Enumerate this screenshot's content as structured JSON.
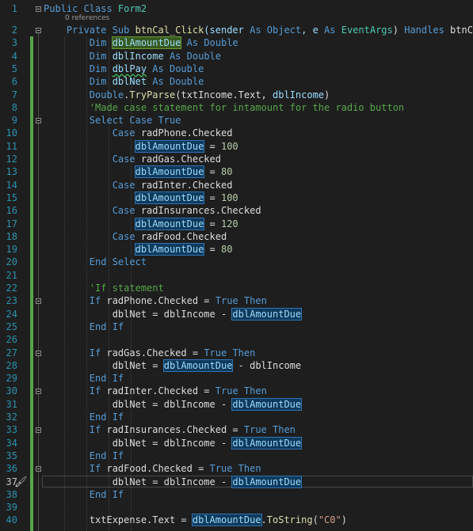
{
  "editor": {
    "reference_hint": "0 references",
    "current_line": 37,
    "colors": {
      "background": "#1e1e1e",
      "line_numbers": "#2b91af",
      "keyword": "#569cd6",
      "type": "#4ec9b0",
      "method": "#dcdcaa",
      "comment": "#57a64a",
      "number": "#b5cea8",
      "string": "#d69d85",
      "highlight": "#0e3a5c"
    },
    "icons": {
      "quick_action": "paintbrush-icon",
      "fold": "collapse-icon"
    }
  },
  "lines": [
    {
      "num": "1",
      "tokens": [
        {
          "t": "Public Class ",
          "c": "k"
        },
        {
          "t": "Form2",
          "c": "t"
        }
      ]
    },
    {
      "num": "2",
      "tokens": [
        {
          "t": "    Private Sub ",
          "c": "k"
        },
        {
          "t": "btnCal_Click",
          "c": "f"
        },
        {
          "t": "(sender ",
          "c": "v"
        },
        {
          "t": "As ",
          "c": "k"
        },
        {
          "t": "Object",
          "c": "k"
        },
        {
          "t": ", e ",
          "c": "v"
        },
        {
          "t": "As ",
          "c": "k"
        },
        {
          "t": "EventArgs",
          "c": "t"
        },
        {
          "t": ") ",
          "c": "p"
        },
        {
          "t": "Handles ",
          "c": "k"
        },
        {
          "t": "btnCal.C",
          "c": "p"
        }
      ]
    },
    {
      "num": "3",
      "tokens": [
        {
          "t": "        Dim ",
          "c": "k"
        },
        {
          "t": "dblAmountDue",
          "c": "v",
          "hl": "def"
        },
        {
          "t": " As ",
          "c": "k"
        },
        {
          "t": "Double",
          "c": "k"
        }
      ]
    },
    {
      "num": "4",
      "tokens": [
        {
          "t": "        Dim ",
          "c": "k"
        },
        {
          "t": "dblIncome",
          "c": "v"
        },
        {
          "t": " As ",
          "c": "k"
        },
        {
          "t": "Double",
          "c": "k"
        }
      ]
    },
    {
      "num": "5",
      "tokens": [
        {
          "t": "        Dim ",
          "c": "k"
        },
        {
          "t": "dblPay",
          "c": "v",
          "sq": true
        },
        {
          "t": " As ",
          "c": "k"
        },
        {
          "t": "Double",
          "c": "k"
        }
      ]
    },
    {
      "num": "6",
      "tokens": [
        {
          "t": "        Dim ",
          "c": "k"
        },
        {
          "t": "dblNet",
          "c": "v"
        },
        {
          "t": " As ",
          "c": "k"
        },
        {
          "t": "Double",
          "c": "k"
        }
      ]
    },
    {
      "num": "7",
      "tokens": [
        {
          "t": "        Double",
          "c": "k"
        },
        {
          "t": ".",
          "c": "p"
        },
        {
          "t": "TryParse",
          "c": "f"
        },
        {
          "t": "(txtIncome.Text, ",
          "c": "p"
        },
        {
          "t": "dblIncome",
          "c": "v"
        },
        {
          "t": ")",
          "c": "p"
        }
      ]
    },
    {
      "num": "8",
      "tokens": [
        {
          "t": "        'Made case statement for intamount for the radio button",
          "c": "c"
        }
      ]
    },
    {
      "num": "9",
      "tokens": [
        {
          "t": "        Select Case ",
          "c": "k"
        },
        {
          "t": "True",
          "c": "k"
        }
      ]
    },
    {
      "num": "10",
      "tokens": [
        {
          "t": "            Case ",
          "c": "k"
        },
        {
          "t": "radPhone.Checked",
          "c": "p"
        }
      ]
    },
    {
      "num": "11",
      "tokens": [
        {
          "t": "                ",
          "c": "p"
        },
        {
          "t": "dblAmountDue",
          "c": "v",
          "hl": "ref"
        },
        {
          "t": " = ",
          "c": "p"
        },
        {
          "t": "100",
          "c": "n"
        }
      ]
    },
    {
      "num": "12",
      "tokens": [
        {
          "t": "            Case ",
          "c": "k"
        },
        {
          "t": "radGas.Checked",
          "c": "p"
        }
      ]
    },
    {
      "num": "13",
      "tokens": [
        {
          "t": "                ",
          "c": "p"
        },
        {
          "t": "dblAmountDue",
          "c": "v",
          "hl": "ref"
        },
        {
          "t": " = ",
          "c": "p"
        },
        {
          "t": "80",
          "c": "n"
        }
      ]
    },
    {
      "num": "14",
      "tokens": [
        {
          "t": "            Case ",
          "c": "k"
        },
        {
          "t": "radInter.Checked",
          "c": "p"
        }
      ]
    },
    {
      "num": "15",
      "tokens": [
        {
          "t": "                ",
          "c": "p"
        },
        {
          "t": "dblAmountDue",
          "c": "v",
          "hl": "ref"
        },
        {
          "t": " = ",
          "c": "p"
        },
        {
          "t": "100",
          "c": "n"
        }
      ]
    },
    {
      "num": "16",
      "tokens": [
        {
          "t": "            Case ",
          "c": "k"
        },
        {
          "t": "radInsurances.Checked",
          "c": "p"
        }
      ]
    },
    {
      "num": "17",
      "tokens": [
        {
          "t": "                ",
          "c": "p"
        },
        {
          "t": "dblAmountDue",
          "c": "v",
          "hl": "ref"
        },
        {
          "t": " = ",
          "c": "p"
        },
        {
          "t": "120",
          "c": "n"
        }
      ]
    },
    {
      "num": "18",
      "tokens": [
        {
          "t": "            Case ",
          "c": "k"
        },
        {
          "t": "radFood.Checked",
          "c": "p"
        }
      ]
    },
    {
      "num": "19",
      "tokens": [
        {
          "t": "                ",
          "c": "p"
        },
        {
          "t": "dblAmountDue",
          "c": "v",
          "hl": "ref"
        },
        {
          "t": " = ",
          "c": "p"
        },
        {
          "t": "80",
          "c": "n"
        }
      ]
    },
    {
      "num": "20",
      "tokens": [
        {
          "t": "        End Select",
          "c": "k"
        }
      ]
    },
    {
      "num": "21",
      "tokens": []
    },
    {
      "num": "22",
      "tokens": [
        {
          "t": "        'If statement",
          "c": "c"
        }
      ]
    },
    {
      "num": "23",
      "tokens": [
        {
          "t": "        If ",
          "c": "k"
        },
        {
          "t": "radPhone.Checked = ",
          "c": "p"
        },
        {
          "t": "True ",
          "c": "k"
        },
        {
          "t": "Then",
          "c": "k"
        }
      ]
    },
    {
      "num": "24",
      "tokens": [
        {
          "t": "            dblNet = dblIncome - ",
          "c": "p"
        },
        {
          "t": "dblAmountDue",
          "c": "v",
          "hl": "ref"
        }
      ]
    },
    {
      "num": "25",
      "tokens": [
        {
          "t": "        End If",
          "c": "k"
        }
      ]
    },
    {
      "num": "26",
      "tokens": []
    },
    {
      "num": "27",
      "tokens": [
        {
          "t": "        If ",
          "c": "k"
        },
        {
          "t": "radGas.Checked = ",
          "c": "p"
        },
        {
          "t": "True ",
          "c": "k"
        },
        {
          "t": "Then",
          "c": "k"
        }
      ]
    },
    {
      "num": "28",
      "tokens": [
        {
          "t": "            dblNet = ",
          "c": "p"
        },
        {
          "t": "dblAmountDue",
          "c": "v",
          "hl": "ref"
        },
        {
          "t": " - dblIncome",
          "c": "p"
        }
      ]
    },
    {
      "num": "29",
      "tokens": [
        {
          "t": "        End If",
          "c": "k"
        }
      ]
    },
    {
      "num": "30",
      "tokens": [
        {
          "t": "        If ",
          "c": "k"
        },
        {
          "t": "radInter.Checked = ",
          "c": "p"
        },
        {
          "t": "True ",
          "c": "k"
        },
        {
          "t": "Then",
          "c": "k"
        }
      ]
    },
    {
      "num": "31",
      "tokens": [
        {
          "t": "            dblNet = dblIncome - ",
          "c": "p"
        },
        {
          "t": "dblAmountDue",
          "c": "v",
          "hl": "ref"
        }
      ]
    },
    {
      "num": "32",
      "tokens": [
        {
          "t": "        End If",
          "c": "k"
        }
      ]
    },
    {
      "num": "33",
      "tokens": [
        {
          "t": "        If ",
          "c": "k"
        },
        {
          "t": "radInsurances.Checked = ",
          "c": "p"
        },
        {
          "t": "True ",
          "c": "k"
        },
        {
          "t": "Then",
          "c": "k"
        }
      ]
    },
    {
      "num": "34",
      "tokens": [
        {
          "t": "            dblNet = dblIncome - ",
          "c": "p"
        },
        {
          "t": "dblAmountDue",
          "c": "v",
          "hl": "ref"
        }
      ]
    },
    {
      "num": "35",
      "tokens": [
        {
          "t": "        End If",
          "c": "k"
        }
      ]
    },
    {
      "num": "36",
      "tokens": [
        {
          "t": "        If ",
          "c": "k"
        },
        {
          "t": "radFood.Checked = ",
          "c": "p"
        },
        {
          "t": "True ",
          "c": "k"
        },
        {
          "t": "Then",
          "c": "k"
        }
      ]
    },
    {
      "num": "37",
      "tokens": [
        {
          "t": "            dblNet = dblIncome - ",
          "c": "p"
        },
        {
          "t": "dblAmountDue",
          "c": "v",
          "hl": "ref"
        }
      ]
    },
    {
      "num": "38",
      "tokens": [
        {
          "t": "        End If",
          "c": "k"
        }
      ]
    },
    {
      "num": "39",
      "tokens": []
    },
    {
      "num": "40",
      "tokens": [
        {
          "t": "        txtExpense.Text = ",
          "c": "p"
        },
        {
          "t": "dblAmountDue",
          "c": "v",
          "hl": "ref"
        },
        {
          "t": ".",
          "c": "p"
        },
        {
          "t": "ToString",
          "c": "f"
        },
        {
          "t": "(",
          "c": "p"
        },
        {
          "t": "\"C0\"",
          "c": "s"
        },
        {
          "t": ")",
          "c": "p"
        }
      ]
    }
  ]
}
